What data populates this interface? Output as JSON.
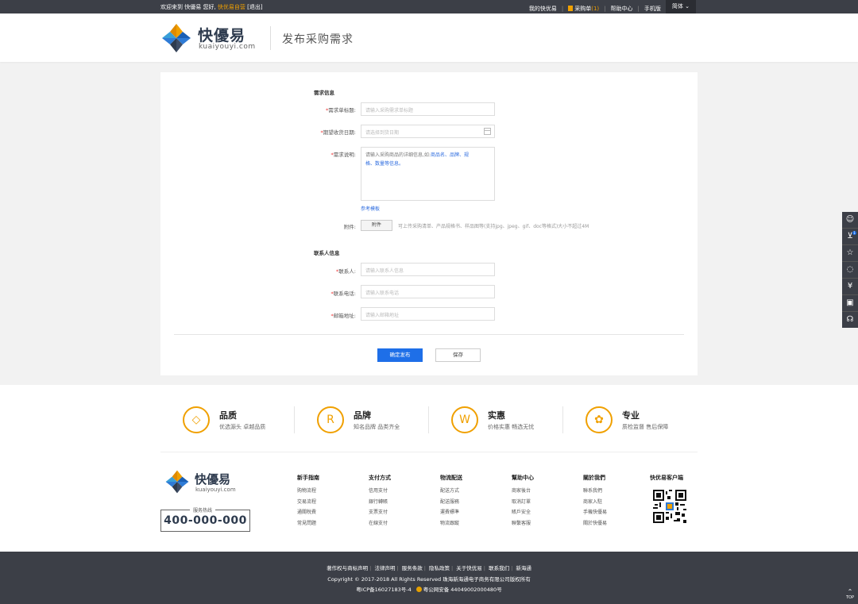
{
  "topbar": {
    "welcome": "欢迎来到 快優易 您好,",
    "store": "快优易自营",
    "logout": "[退出]",
    "my": "我的快优易",
    "cart_label": "采购单",
    "cart_count": "(1)",
    "help": "帮助中心",
    "mobile": "手机版",
    "lang": "简体"
  },
  "header": {
    "brand": "快優易",
    "domain": "kuaiyouyi.com",
    "title": "发布采购需求"
  },
  "form": {
    "section_demand": "需求信息",
    "title_label": "需求单标题:",
    "title_placeholder": "请输入采购需求单标题",
    "date_label": "期望收货日期:",
    "date_placeholder": "请选择到货日期",
    "desc_label": "需求说明:",
    "desc_text_1": "请输入采购商品的详细信息,如:",
    "desc_text_blue_1": "商品名、品牌、规",
    "desc_text_blue_2": "格、数量等信息。",
    "template_link": "参考模板",
    "attach_label": "附件:",
    "attach_button": "附件",
    "attach_tip": "可上传采购清单、产品规格书、样品图等(支持jpg、jpeg、gif、doc等格式)大小不超过4M",
    "section_contact": "联系人信息",
    "contact_label": "联系人:",
    "contact_placeholder": "请输入联系人信息",
    "phone_label": "联系电话:",
    "phone_placeholder": "请输入联系电话",
    "email_label": "邮箱地址:",
    "email_placeholder": "请输入邮箱地址",
    "submit": "确定发布",
    "save": "保存",
    "required_mark": "*"
  },
  "features": [
    {
      "icon": "diamond-icon",
      "glyph": "◇",
      "title": "品质",
      "sub": "优选源头 卓越品质"
    },
    {
      "icon": "brand-badge-icon",
      "glyph": "R",
      "title": "品牌",
      "sub": "知名品牌 品类齐全"
    },
    {
      "icon": "wave-check-icon",
      "glyph": "W",
      "title": "实惠",
      "sub": "价格实惠 畅选无忧"
    },
    {
      "icon": "flower-icon",
      "glyph": "✿",
      "title": "专业",
      "sub": "质检监督 售后保障"
    }
  ],
  "footer": {
    "brand": "快優易",
    "domain": "kuaiyouyi.com",
    "hotline_label": "服务热线",
    "hotline": "400-000-000",
    "columns": [
      {
        "title": "新手指南",
        "items": [
          "购物流程",
          "交易流程",
          "通關稅費",
          "常見問題"
        ]
      },
      {
        "title": "支付方式",
        "items": [
          "信用支付",
          "銀行轉賬",
          "支票支付",
          "在線支付"
        ]
      },
      {
        "title": "物流配送",
        "items": [
          "配送方式",
          "配送服務",
          "運費標準",
          "物流跟蹤"
        ]
      },
      {
        "title": "幫助中心",
        "items": [
          "商家後台",
          "取消訂單",
          "賬戶安全",
          "聯繫客服"
        ]
      },
      {
        "title": "關於我們",
        "items": [
          "聯系我們",
          "商家入駐",
          "手機快優易",
          "關於快優易"
        ]
      }
    ],
    "client_title": "快优易客户端"
  },
  "bottom": {
    "links": [
      "著作权与商标声明",
      "法律声明",
      "服务条款",
      "隐私政策",
      "关于快优易",
      "联系我们",
      "新海通"
    ],
    "copyright": "Copyright © 2017-2018 All Rights Reserved 珠海新海通电子商务有限公司版权所有",
    "icp": "粤ICP备16027183号-4",
    "police": "粤公网安备 44049002000480号"
  },
  "sidebar": {
    "items": [
      "user-icon",
      "cart-icon",
      "star-icon",
      "chat-icon",
      "yen-icon",
      "bag-icon",
      "service-icon"
    ],
    "cart_badge": "1",
    "totop": "TOP"
  },
  "colors": {
    "accent": "#1e6fe8",
    "orange": "#f0a000",
    "dark": "#3c3f47"
  }
}
